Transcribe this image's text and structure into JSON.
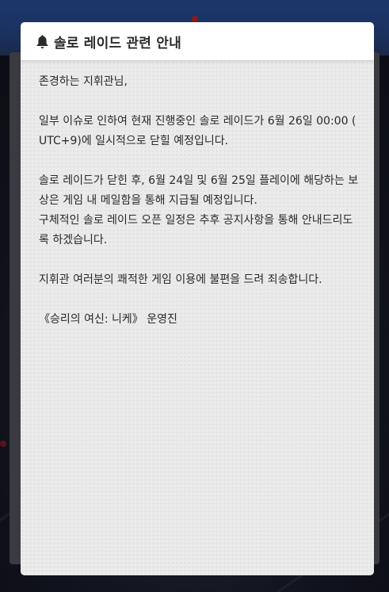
{
  "notice": {
    "title": "솔로 레이드 관련 안내",
    "icon": "bell-icon",
    "greeting": "존경하는 지휘관님,",
    "paragraph1": [
      "일부 이슈로 인하여 현재 진행중인 솔로 레이드가 6월 26일 00:00 (",
      "UTC+9)에 일시적으로 닫힐 예정입니다."
    ],
    "paragraph2": [
      "솔로 레이드가 닫힌 후, 6월 24일 및 6월 25일 플레이에 해당하는 보",
      "상은 게임 내 메일함을 통해 지급될 예정입니다.",
      "구체적인 솔로 레이드 오픈 일정은 추후 공지사항을 통해 안내드리도",
      "록 하겠습니다."
    ],
    "apology": "지휘관 여러분의 쾌적한 게임 이용에 불편을 드려 죄송합니다.",
    "signature": "《승리의 여신: 니케》 운영진"
  },
  "colors": {
    "dialog_bg": "#ebebeb",
    "header_bg": "#ffffff",
    "text": "#2a2a2a",
    "accent_red": "#d8252a"
  }
}
